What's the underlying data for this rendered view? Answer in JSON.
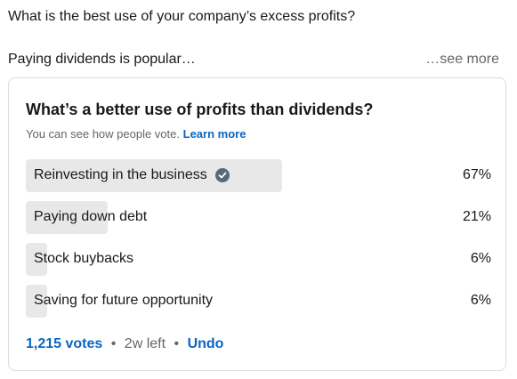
{
  "post": {
    "question": "What is the best use of your company’s excess profits?",
    "teaser": "Paying dividends is popular…",
    "see_more": "…see more"
  },
  "poll": {
    "title": "What’s a better use of profits than dividends?",
    "subtitle": "You can see how people vote.",
    "learn_more": "Learn more",
    "options": [
      {
        "label": "Reinvesting in the business",
        "percent": "67%",
        "fraction": 0.55,
        "selected": true
      },
      {
        "label": "Paying down debt",
        "percent": "21%",
        "fraction": 0.175,
        "selected": false
      },
      {
        "label": "Stock buybacks",
        "percent": "6%",
        "fraction": 0.045,
        "selected": false
      },
      {
        "label": "Saving for future opportunity",
        "percent": "6%",
        "fraction": 0.045,
        "selected": false
      }
    ],
    "votes": "1,215 votes",
    "time_left": "2w left",
    "undo": "Undo",
    "bullet": "•"
  },
  "colors": {
    "link": "#0a66c2",
    "bar": "#e8e8e8",
    "check": "#56687a"
  }
}
